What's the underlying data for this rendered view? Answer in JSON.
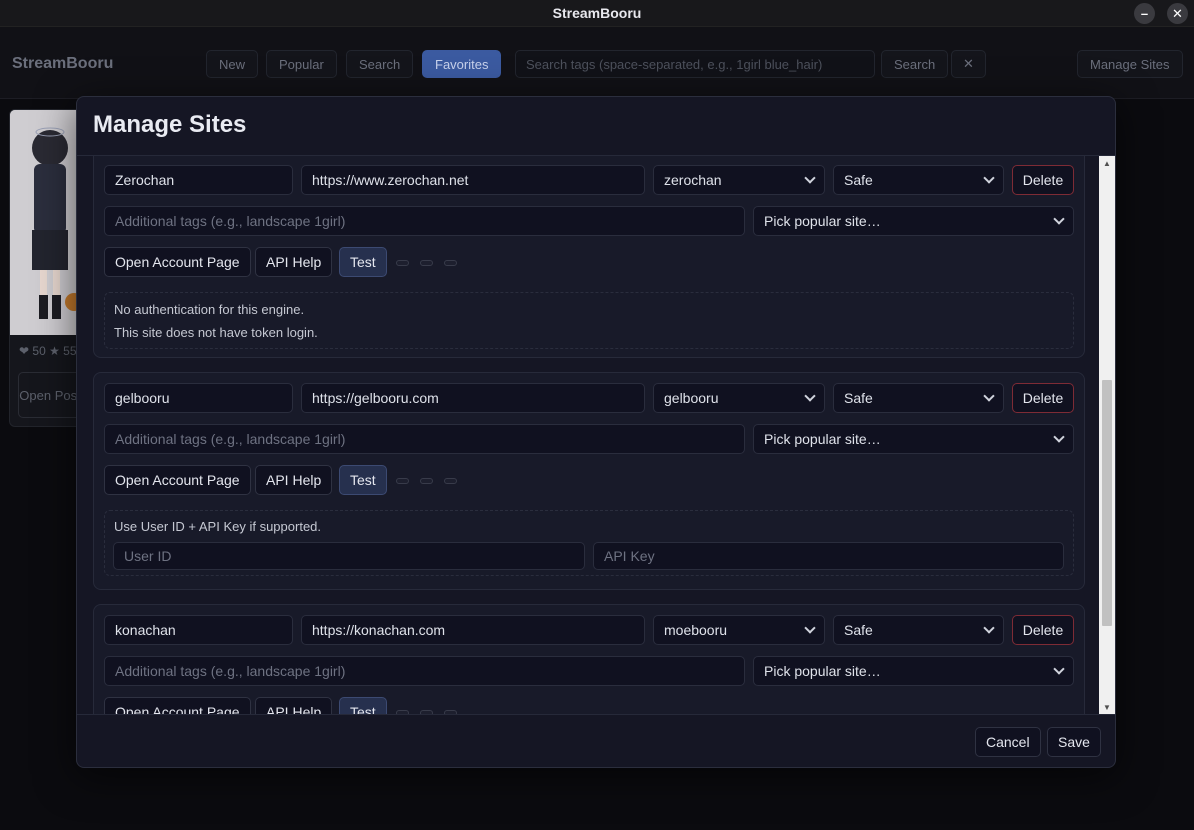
{
  "window": {
    "title": "StreamBooru",
    "minimize": "–",
    "close": "✕"
  },
  "appbar": {
    "brand": "StreamBooru",
    "nav": [
      "New",
      "Popular",
      "Search",
      "Favorites"
    ],
    "active_nav": "Favorites",
    "search_placeholder": "Search tags (space-separated, e.g., 1girl blue_hair)",
    "search_button": "Search",
    "clear_button": "✕",
    "manage_sites": "Manage Sites"
  },
  "background_card": {
    "likes": "❤ 50",
    "stars": "★ 55",
    "open_post": "Open Post"
  },
  "modal": {
    "title": "Manage Sites",
    "labels": {
      "tags_placeholder": "Additional tags (e.g., landscape 1girl)",
      "pick_site": "Pick popular site…",
      "open_account": "Open Account Page",
      "api_help": "API Help",
      "test": "Test",
      "delete": "Delete",
      "user_id_placeholder": "User ID",
      "api_key_placeholder": "API Key"
    },
    "sites": [
      {
        "name": "Zerochan",
        "url": "https://www.zerochan.net",
        "engine": "zerochan",
        "rating": "Safe",
        "auth_lines": [
          "No authentication for this engine.",
          "This site does not have token login."
        ]
      },
      {
        "name": "gelbooru",
        "url": "https://gelbooru.com",
        "engine": "gelbooru",
        "rating": "Safe",
        "auth_lines": [
          "Use User ID + API Key if supported."
        ]
      },
      {
        "name": "konachan",
        "url": "https://konachan.com",
        "engine": "moebooru",
        "rating": "Safe"
      }
    ],
    "cancel": "Cancel",
    "save": "Save"
  }
}
